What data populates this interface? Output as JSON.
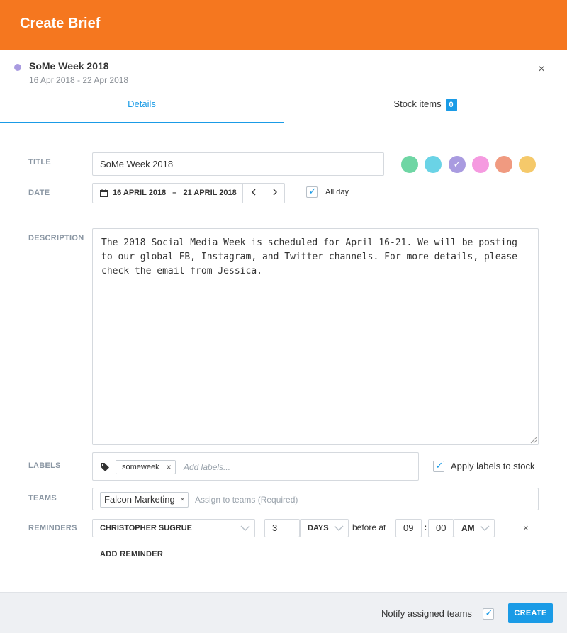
{
  "header": {
    "title": "Create Brief"
  },
  "brief": {
    "name": "SoMe Week 2018",
    "dates": "16 Apr 2018 - 22 Apr 2018",
    "dot_color": "#a99be0"
  },
  "tabs": [
    {
      "label": "Details",
      "active": true
    },
    {
      "label": "Stock items",
      "badge": "0",
      "active": false
    }
  ],
  "form": {
    "title": {
      "label": "TITLE",
      "value": "SoMe Week 2018"
    },
    "colors": [
      {
        "hex": "#6fd6a4",
        "selected": false
      },
      {
        "hex": "#6ad3e6",
        "selected": false
      },
      {
        "hex": "#a99be0",
        "selected": true
      },
      {
        "hex": "#f59ae0",
        "selected": false
      },
      {
        "hex": "#f09a80",
        "selected": false
      },
      {
        "hex": "#f5c96a",
        "selected": false
      }
    ],
    "date": {
      "label": "DATE",
      "start": "16 APRIL 2018",
      "separator": "–",
      "end": "21 APRIL 2018",
      "prev_icon": "chevron-left-icon",
      "next_icon": "chevron-right-icon",
      "all_day": {
        "label": "All day",
        "checked": true
      }
    },
    "description": {
      "label": "DESCRIPTION",
      "value": "The 2018 Social Media Week is scheduled for April 16-21. We will be posting to our global FB, Instagram, and Twitter channels. For more details, please check the email from Jessica."
    },
    "labels": {
      "label": "LABELS",
      "chips": [
        "someweek"
      ],
      "placeholder": "Add labels...",
      "apply": {
        "label": "Apply labels to stock",
        "checked": true
      }
    },
    "teams": {
      "label": "TEAMS",
      "chips": [
        "Falcon Marketing"
      ],
      "placeholder": "Assign to teams (Required)"
    },
    "reminders": {
      "label": "REMINDERS",
      "person": "CHRISTOPHER SUGRUE",
      "amount": "3",
      "unit": "DAYS",
      "before_at": "before at",
      "hour": "09",
      "minute": "00",
      "ampm": "AM",
      "add_label": "ADD REMINDER"
    }
  },
  "footer": {
    "notify": {
      "label": "Notify assigned teams",
      "checked": true
    },
    "create_label": "CREATE"
  },
  "accent": "#1a9be6",
  "brand": "#f5771f"
}
